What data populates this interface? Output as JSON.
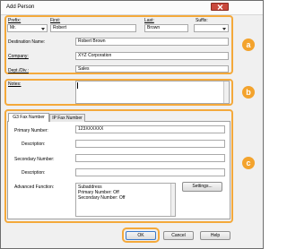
{
  "window": {
    "title": "Add Person"
  },
  "name": {
    "prefix_label": "Prefix:",
    "prefix_value": "Mr.",
    "first_label": "First:",
    "first_value": "Robert",
    "last_label": "Last:",
    "last_value": "Brown",
    "suffix_label": "Suffix:",
    "suffix_value": ""
  },
  "details": {
    "destination_label": "Destination Name:",
    "destination_value": "Robert Brown",
    "company_label": "Company:",
    "company_value": "XYZ Corporation",
    "dept_label": "Dept./Div.:",
    "dept_value": "Sales"
  },
  "notes": {
    "label": "Notes:",
    "value": ""
  },
  "tabs": [
    {
      "label": "G3 Fax Number"
    },
    {
      "label": "IP Fax Number"
    }
  ],
  "fax": {
    "primary_label": "Primary Number:",
    "primary_value": "123XXXXXX",
    "description1_label": "Description:",
    "description1_value": "",
    "secondary_label": "Secondary Number:",
    "secondary_value": "",
    "description2_label": "Description:",
    "description2_value": "",
    "advanced_label": "Advanced Function:",
    "advanced_lines": [
      "Subaddress",
      "Primary Number:    Off",
      "Secondary Number: Off"
    ],
    "settings_label": "Settings..."
  },
  "buttons": {
    "ok": "OK",
    "cancel": "Cancel",
    "help": "Help"
  },
  "callouts": {
    "a": "a",
    "b": "b",
    "c": "c"
  },
  "colors": {
    "highlight": "#f4a93b",
    "callout": "#f3a32d",
    "close": "#c9483c"
  }
}
